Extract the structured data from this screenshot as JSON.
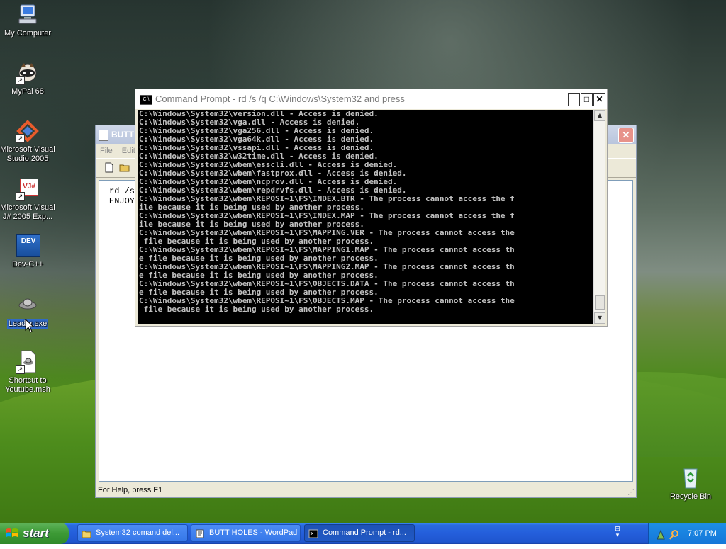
{
  "desktop": {
    "icons": [
      {
        "name": "my-computer-icon",
        "label": "My Computer"
      },
      {
        "name": "mypal-icon",
        "label": "MyPal 68"
      },
      {
        "name": "visual-studio-icon",
        "label": "Microsoft Visual Studio 2005"
      },
      {
        "name": "visual-jsharp-icon",
        "label": "Microsoft Visual J# 2005 Exp..."
      },
      {
        "name": "dev-cpp-icon",
        "label": "Dev-C++"
      },
      {
        "name": "leader-exe-icon",
        "label": "Leader.exe"
      },
      {
        "name": "youtube-shortcut-icon",
        "label": "Shortcut to Youtube.msh"
      },
      {
        "name": "recycle-bin-icon",
        "label": "Recycle Bin"
      }
    ],
    "dev_badge": "DEV",
    "vj_badge": "VJ#"
  },
  "wordpad": {
    "title": "BUTT",
    "menu": [
      "File",
      "Edit"
    ],
    "doc_lines": [
      "rd /s",
      "ENJOY"
    ],
    "status": "For Help, press F1"
  },
  "cmd": {
    "title": "Command Prompt - rd /s /q C:\\Windows\\System32 and press",
    "icon_text": "C:\\",
    "lines": [
      "C:\\Windows\\System32\\version.dll - Access is denied.",
      "C:\\Windows\\System32\\vga.dll - Access is denied.",
      "C:\\Windows\\System32\\vga256.dll - Access is denied.",
      "C:\\Windows\\System32\\vga64k.dll - Access is denied.",
      "C:\\Windows\\System32\\vssapi.dll - Access is denied.",
      "C:\\Windows\\System32\\w32time.dll - Access is denied.",
      "C:\\Windows\\System32\\wbem\\esscli.dll - Access is denied.",
      "C:\\Windows\\System32\\wbem\\fastprox.dll - Access is denied.",
      "C:\\Windows\\System32\\wbem\\ncprov.dll - Access is denied.",
      "C:\\Windows\\System32\\wbem\\repdrvfs.dll - Access is denied.",
      "C:\\Windows\\System32\\wbem\\REPOSI~1\\FS\\INDEX.BTR - The process cannot access the f",
      "ile because it is being used by another process.",
      "C:\\Windows\\System32\\wbem\\REPOSI~1\\FS\\INDEX.MAP - The process cannot access the f",
      "ile because it is being used by another process.",
      "C:\\Windows\\System32\\wbem\\REPOSI~1\\FS\\MAPPING.VER - The process cannot access the",
      " file because it is being used by another process.",
      "C:\\Windows\\System32\\wbem\\REPOSI~1\\FS\\MAPPING1.MAP - The process cannot access th",
      "e file because it is being used by another process.",
      "C:\\Windows\\System32\\wbem\\REPOSI~1\\FS\\MAPPING2.MAP - The process cannot access th",
      "e file because it is being used by another process.",
      "C:\\Windows\\System32\\wbem\\REPOSI~1\\FS\\OBJECTS.DATA - The process cannot access th",
      "e file because it is being used by another process.",
      "C:\\Windows\\System32\\wbem\\REPOSI~1\\FS\\OBJECTS.MAP - The process cannot access the",
      " file because it is being used by another process."
    ]
  },
  "taskbar": {
    "start_label": "start",
    "tasks": [
      {
        "label": "System32 comand del...",
        "active": false
      },
      {
        "label": "BUTT HOLES - WordPad",
        "active": false
      },
      {
        "label": "Command Prompt - rd...",
        "active": true
      }
    ],
    "clock": "7:07 PM"
  },
  "colors": {
    "console_bg": "#000000",
    "console_fg": "#c0c0c0",
    "taskbar": "#245edb",
    "start": "#3c9a35"
  }
}
